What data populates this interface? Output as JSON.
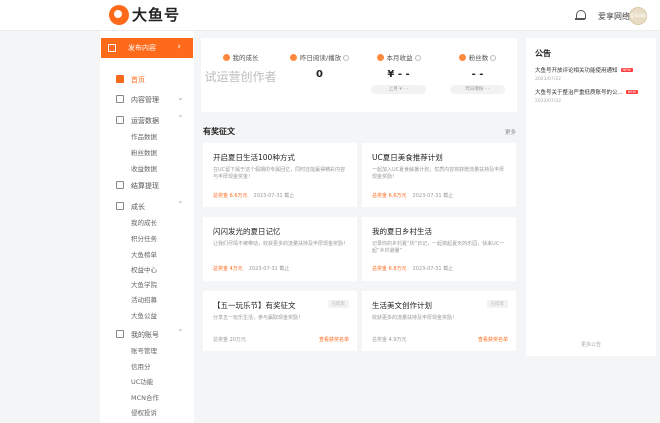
{
  "header": {
    "logo_text": "大鱼号",
    "username": "爱享网络",
    "avatar_text": "爱享网络"
  },
  "sidebar": {
    "publish_label": "发布内容",
    "home": "首页",
    "content_mgmt": "内容管理",
    "ops_data": "运营数据",
    "ops_sub": [
      "作品数据",
      "粉丝数据",
      "收益数据"
    ],
    "earnings": "结算提现",
    "growth": "成长",
    "growth_sub": [
      "我的成长",
      "积分任务",
      "大鱼榜单",
      "权益中心",
      "大鱼学院",
      "活动招募",
      "大鱼公益"
    ],
    "account": "我的账号",
    "account_sub": [
      "账号管理",
      "信用分",
      "UC功能",
      "MCN合作",
      "侵权投诉"
    ]
  },
  "stats": [
    {
      "label": "我的成长",
      "value": "试运营创作者",
      "pill": ""
    },
    {
      "label": "昨日阅读/播放",
      "value": "0",
      "pill": ""
    },
    {
      "label": "本月收益",
      "value": "¥ - -",
      "pill": "上月 ¥ - -"
    },
    {
      "label": "粉丝数",
      "value": "- -",
      "pill": "昨日增粉 - -"
    }
  ],
  "section": {
    "title": "有奖征文",
    "more": "更多"
  },
  "cards": [
    {
      "title": "开启夏日生活100种方式",
      "desc": "在UC留下属于这个假期的专属回忆，同时还能赢得精彩内容与丰厚现金奖金！",
      "prize": "总奖金 6.6万元",
      "deadline": "2023-07-31 截止",
      "tag": "",
      "action": ""
    },
    {
      "title": "UC夏日美食推荐计划",
      "desc": "一起加入UC夏食解暑计划，优质内容将获赠流量扶持及丰厚现金奖励！",
      "prize": "总奖金 6.6万元",
      "deadline": "2023-07-31 截止",
      "tag": "",
      "action": ""
    },
    {
      "title": "闪闪发光的夏日记忆",
      "desc": "让我们尽情不被带动，收获更多的流量扶持及丰厚现金奖励！",
      "prize": "总奖金 4万元",
      "deadline": "2023-07-31 截止",
      "tag": "",
      "action": ""
    },
    {
      "title": "我的夏日乡村生活",
      "desc": "记录你的乡村夏“伏”日记，一起搞起夏天的乐园，快来UC一起“乡村避暑”",
      "prize": "总奖金 6.8万元",
      "deadline": "2023-07-31 截止",
      "tag": "",
      "action": ""
    },
    {
      "title": "【五一玩乐节】有奖征文",
      "desc": "分享五一玩乐生活，参与赢取现金奖励！",
      "prize": "总奖金 20万元",
      "deadline": "",
      "tag": "已结束",
      "action": "查看获奖名单"
    },
    {
      "title": "生活美文创作计划",
      "desc": "收获更多的流量扶持及丰厚现金奖励！",
      "prize": "总奖金 4.9万元",
      "deadline": "",
      "tag": "已结束",
      "action": "查看获奖名单"
    }
  ],
  "notice": {
    "title": "公告",
    "items": [
      {
        "title": "大鱼号开放评论相关功能使用通知",
        "badge": "NEW",
        "date": "2023/07/22"
      },
      {
        "title": "大鱼号关于整治严重低质账号的公...",
        "badge": "NEW",
        "date": "2023/07/22"
      }
    ],
    "more": "更多公告"
  },
  "colors": {
    "accent": "#ff6a1a"
  }
}
